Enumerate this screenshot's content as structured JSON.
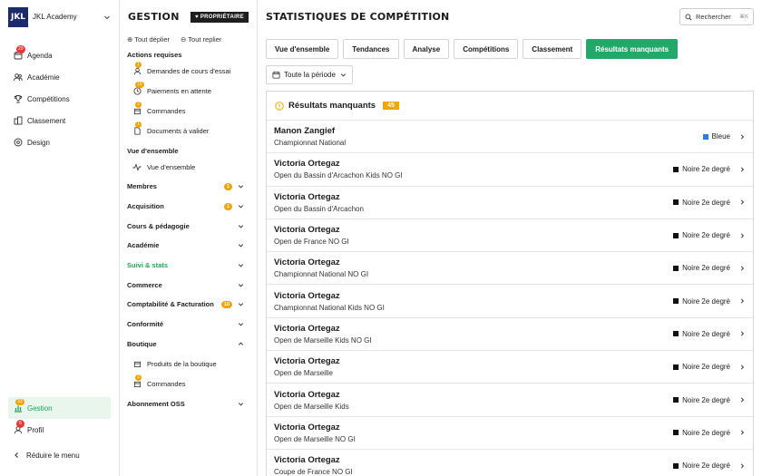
{
  "app": {
    "logo_text": "JKL",
    "name": "JKL Academy"
  },
  "left_nav": {
    "items": [
      {
        "label": "Agenda",
        "badge": "20",
        "icon": "calendar-icon"
      },
      {
        "label": "Académie",
        "badge": null,
        "icon": "users-icon"
      },
      {
        "label": "Compétitions",
        "badge": null,
        "icon": "trophy-icon"
      },
      {
        "label": "Classement",
        "badge": null,
        "icon": "building-icon"
      },
      {
        "label": "Design",
        "badge": null,
        "icon": "palette-icon"
      }
    ],
    "gestion": {
      "label": "Gestion",
      "badge": "33"
    },
    "profil": {
      "label": "Profil",
      "badge": "6"
    },
    "reduce_label": "Réduire le menu"
  },
  "mid": {
    "title": "GESTION",
    "owner_badge": "PROPRIÉTAIRE",
    "expand_all": "Tout déplier",
    "collapse_all": "Tout replier",
    "actions_label": "Actions requises",
    "actions": [
      {
        "label": "Demandes de cours d'essai",
        "badge": "1"
      },
      {
        "label": "Paiements en attente",
        "badge": "10"
      },
      {
        "label": "Commandes",
        "badge": "2"
      },
      {
        "label": "Documents à valider",
        "badge": "1"
      }
    ],
    "overview_label": "Vue d'ensemble",
    "overview_item": "Vue d'ensemble",
    "groups": [
      {
        "label": "Membres",
        "badge": "1"
      },
      {
        "label": "Acquisition",
        "badge": "1"
      },
      {
        "label": "Cours & pédagogie",
        "badge": null
      },
      {
        "label": "Académie",
        "badge": null
      },
      {
        "label": "Suivi & stats",
        "badge": null
      },
      {
        "label": "Commerce",
        "badge": null
      },
      {
        "label": "Comptabilité & Facturation",
        "badge": "10"
      },
      {
        "label": "Conformité",
        "badge": null
      },
      {
        "label": "Boutique",
        "badge": null
      }
    ],
    "boutique_items": [
      {
        "label": "Produits de la boutique",
        "badge": null
      },
      {
        "label": "Commandes",
        "badge": "2"
      }
    ],
    "last_group": "Abonnement OSS"
  },
  "main": {
    "title": "STATISTIQUES DE COMPÉTITION",
    "search_label": "Rechercher",
    "search_kbd": "⌘K",
    "tabs": [
      "Vue d'ensemble",
      "Tendances",
      "Analyse",
      "Compétitions",
      "Classement",
      "Résultats manquants"
    ],
    "period": "Toute la période",
    "panel_title": "Résultats manquants",
    "panel_count": "45",
    "rows": [
      {
        "name": "Manon Zangief",
        "comp": "Championnat National",
        "belt": "Bleue",
        "color": "#2b7de9"
      },
      {
        "name": "Victoria Ortegaz",
        "comp": "Open du Bassin d'Arcachon Kids NO GI",
        "belt": "Noire 2e degré",
        "color": "#111111"
      },
      {
        "name": "Victoria Ortegaz",
        "comp": "Open du Bassin d'Arcachon",
        "belt": "Noire 2e degré",
        "color": "#111111"
      },
      {
        "name": "Victoria Ortegaz",
        "comp": "Open de France NO GI",
        "belt": "Noire 2e degré",
        "color": "#111111"
      },
      {
        "name": "Victoria Ortegaz",
        "comp": "Championnat National NO GI",
        "belt": "Noire 2e degré",
        "color": "#111111"
      },
      {
        "name": "Victoria Ortegaz",
        "comp": "Championnat National Kids NO GI",
        "belt": "Noire 2e degré",
        "color": "#111111"
      },
      {
        "name": "Victoria Ortegaz",
        "comp": "Open de Marseille Kids NO GI",
        "belt": "Noire 2e degré",
        "color": "#111111"
      },
      {
        "name": "Victoria Ortegaz",
        "comp": "Open de Marseille",
        "belt": "Noire 2e degré",
        "color": "#111111"
      },
      {
        "name": "Victoria Ortegaz",
        "comp": "Open de Marseille Kids",
        "belt": "Noire 2e degré",
        "color": "#111111"
      },
      {
        "name": "Victoria Ortegaz",
        "comp": "Open de Marseille NO GI",
        "belt": "Noire 2e degré",
        "color": "#111111"
      },
      {
        "name": "Victoria Ortegaz",
        "comp": "Coupe de France NO GI",
        "belt": "Noire 2e degré",
        "color": "#111111"
      }
    ]
  }
}
